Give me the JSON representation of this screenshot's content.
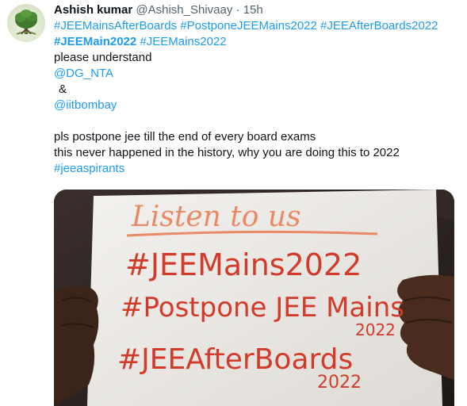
{
  "author": {
    "name": "Ashish kumar",
    "handle": "@Ashish_Shivaay",
    "separator": "·",
    "time": "15h",
    "avatar_icon": "tree-icon"
  },
  "tweet": {
    "hashtags_line1": [
      "#JEEMainsAfterBoards",
      "#PostponeJEEMains2022",
      "#JEEAfterBoards2022"
    ],
    "hashtag_bold": "#JEEMain2022",
    "hashtag_line2": "#JEEMains2022",
    "please": "please understand",
    "mention1": "@DG_NTA",
    "amp": "&",
    "mention2": "@iitbombay",
    "body_line1": "pls postpone jee till the end of every board exams",
    "body_line2": "this never happened in the history, why you are doing this to 2022",
    "closing_tag": "#jeeaspirants"
  },
  "media": {
    "sign_title": "Listen to us",
    "sign_line1": "#JEEMains2022",
    "sign_line2": "#Postpone JEE Mains",
    "sign_year2": "2022",
    "sign_line3": "#JEEAfterBoards",
    "sign_year3": "2022",
    "ink_color": "#d23a2a",
    "title_color": "#e98a66"
  },
  "colors": {
    "link": "#1d9bf0",
    "muted": "#536471",
    "text": "#0f1419"
  }
}
